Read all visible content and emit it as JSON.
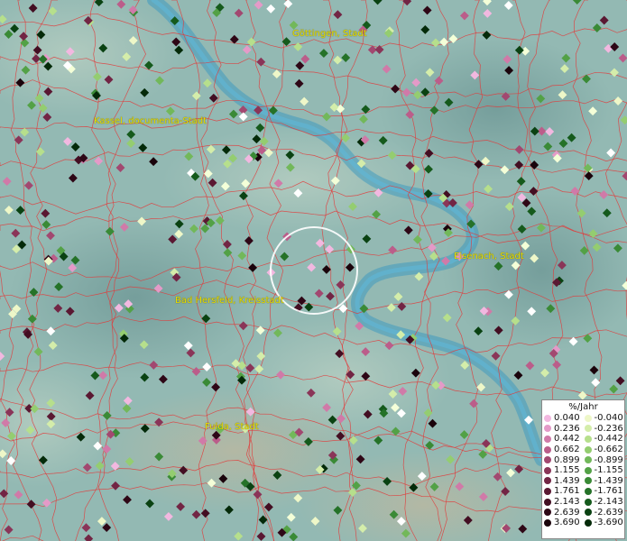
{
  "cities": [
    {
      "name": "Göttingen, Stadt"
    },
    {
      "name": "Kassel, documenta-Stadt"
    },
    {
      "name": "Eisenach, Stadt"
    },
    {
      "name": "Bad Hersfeld, Kreisstadt"
    },
    {
      "name": "Fulda, Stadt"
    }
  ],
  "legend": {
    "title": "%/Jahr",
    "positive": [
      {
        "label": "0.040",
        "color": "#f2b8e0"
      },
      {
        "label": "0.236",
        "color": "#e49ac8"
      },
      {
        "label": "0.442",
        "color": "#d07aa8"
      },
      {
        "label": "0.662",
        "color": "#bb5d8a"
      },
      {
        "label": "0.899",
        "color": "#a24870"
      },
      {
        "label": "1.155",
        "color": "#8a3558"
      },
      {
        "label": "1.439",
        "color": "#722544"
      },
      {
        "label": "1.761",
        "color": "#5a1832"
      },
      {
        "label": "2.143",
        "color": "#430e22"
      },
      {
        "label": "2.639",
        "color": "#2e0716"
      },
      {
        "label": "3.690",
        "color": "#1a030b"
      }
    ],
    "negative": [
      {
        "label": "-0.040",
        "color": "#eef7c8"
      },
      {
        "label": "-0.236",
        "color": "#d4edaa"
      },
      {
        "label": "-0.442",
        "color": "#b6df8c"
      },
      {
        "label": "-0.662",
        "color": "#94cd70"
      },
      {
        "label": "-0.899",
        "color": "#72b85a"
      },
      {
        "label": "-1.155",
        "color": "#53a146"
      },
      {
        "label": "-1.439",
        "color": "#3a8a36"
      },
      {
        "label": "-1.761",
        "color": "#257228"
      },
      {
        "label": "-2.143",
        "color": "#155a1c"
      },
      {
        "label": "-2.639",
        "color": "#0a4212"
      },
      {
        "label": "-3.690",
        "color": "#042a09"
      }
    ]
  }
}
